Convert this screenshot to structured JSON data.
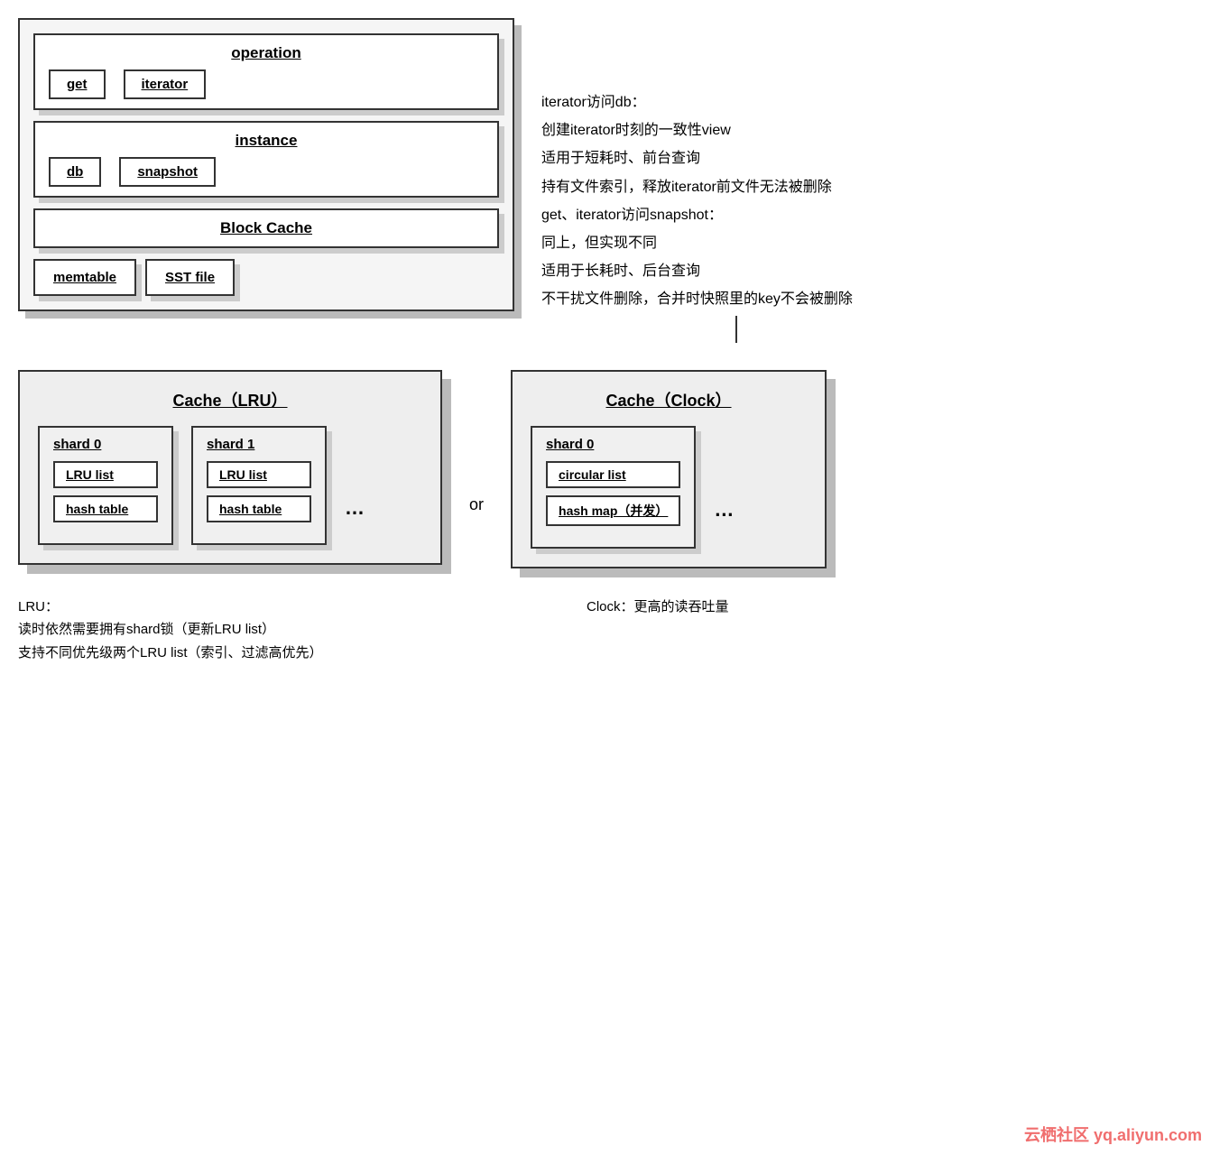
{
  "topDiagram": {
    "operationBox": {
      "title": "operation",
      "items": [
        "get",
        "iterator"
      ]
    },
    "instanceBox": {
      "title": "instance",
      "items": [
        "db",
        "snapshot"
      ]
    },
    "blockCacheLabel": "Block Cache",
    "memtableLabel": "memtable",
    "sstFileLabel": "SST file"
  },
  "rightText": {
    "lines": [
      "iterator访问db：",
      "创建iterator时刻的一致性view",
      "适用于短耗时、前台查询",
      "持有文件索引，释放iterator前文件无法被删除",
      "get、iterator访问snapshot：",
      "同上，但实现不同",
      "适用于长耗时、后台查询",
      "不干扰文件删除，合并时快照里的key不会被删除"
    ]
  },
  "lruCache": {
    "title": "Cache（LRU）",
    "shards": [
      {
        "title": "shard 0",
        "items": [
          "LRU list",
          "hash table"
        ]
      },
      {
        "title": "shard 1",
        "items": [
          "LRU list",
          "hash table"
        ]
      }
    ],
    "ellipsis": "…"
  },
  "orLabel": "or",
  "clockCache": {
    "title": "Cache（Clock）",
    "shards": [
      {
        "title": "shard 0",
        "items": [
          "circular list",
          "hash map（并发）"
        ]
      }
    ],
    "ellipsis": "…"
  },
  "lruDesc": {
    "lines": [
      "LRU：",
      "读时依然需要拥有shard锁（更新LRU list）",
      "支持不同优先级两个LRU list（索引、过滤高优先）"
    ]
  },
  "clockDesc": {
    "lines": [
      "Clock：更高的读吞吐量"
    ]
  },
  "watermark": "云栖社区 yq.aliyun.com"
}
